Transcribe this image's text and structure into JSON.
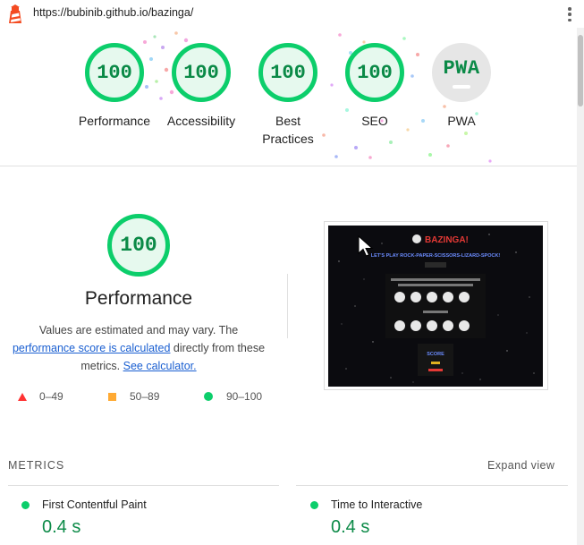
{
  "browser": {
    "url": "https://bubinib.github.io/bazinga/"
  },
  "summary": [
    {
      "label": "Performance",
      "score": "100"
    },
    {
      "label": "Accessibility",
      "score": "100"
    },
    {
      "label": "Best Practices",
      "score": "100"
    },
    {
      "label": "SEO",
      "score": "100"
    },
    {
      "label": "PWA",
      "score": "PWA"
    }
  ],
  "performance": {
    "score": "100",
    "title": "Performance",
    "desc_pre": "Values are estimated and may vary. The ",
    "desc_link1": "performance score is calculated",
    "desc_mid": " directly from these metrics. ",
    "desc_link2": "See calculator.",
    "legend": [
      {
        "range": "0–49",
        "color": "#ff3333",
        "shape": "triangle"
      },
      {
        "range": "50–89",
        "color": "#ffaa33",
        "shape": "square"
      },
      {
        "range": "90–100",
        "color": "#0cce6b",
        "shape": "circle"
      }
    ]
  },
  "thumbnail": {
    "heading": "BAZINGA!",
    "subtitle": "LET'S PLAY ROCK-PAPER-SCISSORS-LIZARD-SPOCK!",
    "score_label": "SCORE"
  },
  "metrics": {
    "header": "METRICS",
    "expand_label": "Expand view",
    "items": [
      {
        "name": "First Contentful Paint",
        "value": "0.4 s"
      },
      {
        "name": "Time to Interactive",
        "value": "0.4 s"
      }
    ]
  },
  "colors": {
    "pass": "#0cce6b",
    "pass_text": "#0b8a47",
    "link": "#1a5fd1"
  }
}
